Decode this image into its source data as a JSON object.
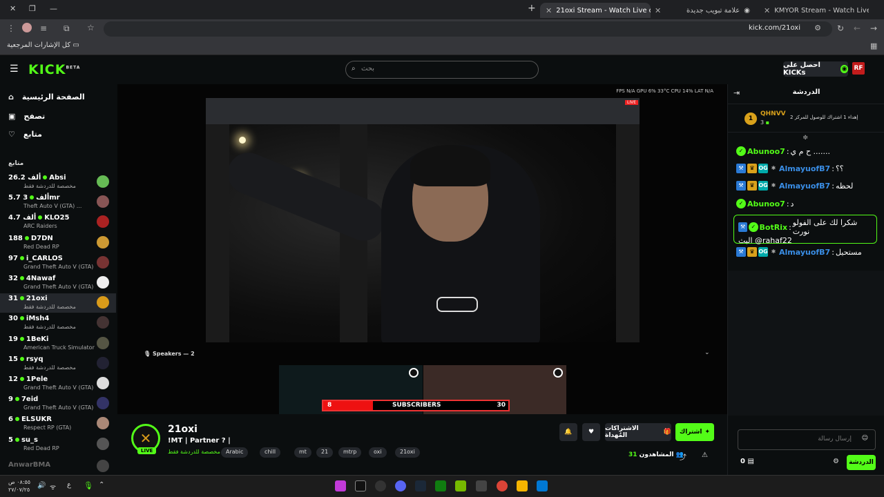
{
  "browser": {
    "tabs": [
      {
        "title": "21oxi Stream - Watch Live o",
        "active": true
      },
      {
        "title": "علامة تبويب جديدة",
        "active": false
      },
      {
        "title": "KMYOR Stream - Watch Live on",
        "active": false
      }
    ],
    "url": "kick.com/21oxi",
    "bookmarks_all": "كل الإشارات المرجعية"
  },
  "header": {
    "logo": "KICK",
    "logo_badge": "BETA",
    "search_placeholder": "بحث",
    "get_kicks": "احصل على KICKs",
    "user_avatar": "RF"
  },
  "sidebar": {
    "nav": [
      {
        "label": "الصفحة الرئيسية",
        "icon": "home-icon"
      },
      {
        "label": "تصفح",
        "icon": "browse-icon"
      },
      {
        "label": "متابع",
        "icon": "heart-icon"
      }
    ],
    "following_title": "متابع",
    "channels": [
      {
        "viewers": "26.2 ألف",
        "name": "Absi",
        "category": "مخصصة للدردشة فقط"
      },
      {
        "viewers": "5.7 ألف",
        "name": "3mr",
        "category": "Theft Auto V (GTA) ..."
      },
      {
        "viewers": "4.7 ألف",
        "name": "KLO25",
        "category": "ARC Raiders"
      },
      {
        "viewers": "188",
        "name": "D7DN",
        "category": "Red Dead RP"
      },
      {
        "viewers": "97",
        "name": "i_CARLOS",
        "category": "Grand Theft Auto V (GTA)"
      },
      {
        "viewers": "32",
        "name": "4Nawaf",
        "category": "Grand Theft Auto V (GTA)"
      },
      {
        "viewers": "31",
        "name": "21oxi",
        "category": "مخصصة للدردشة فقط",
        "active": true
      },
      {
        "viewers": "30",
        "name": "iMsh4",
        "category": "مخصصة للدردشة فقط"
      },
      {
        "viewers": "19",
        "name": "1BeKi",
        "category": "American Truck Simulator"
      },
      {
        "viewers": "15",
        "name": "rsyq",
        "category": "مخصصة للدردشة فقط"
      },
      {
        "viewers": "12",
        "name": "1Pele",
        "category": "Grand Theft Auto V (GTA)"
      },
      {
        "viewers": "9",
        "name": "7eid",
        "category": "Grand Theft Auto V (GTA)"
      },
      {
        "viewers": "6",
        "name": "ELSUKR",
        "category": "Respect RP (GTA)"
      },
      {
        "viewers": "5",
        "name": "su_s",
        "category": "Red Dead RP"
      }
    ],
    "offline_channel": "AnwarBMA"
  },
  "video": {
    "stats": "FPS N/A   GPU 6%  33°C   CPU 14%   LAT N/A",
    "live_label": "LIVE",
    "speakers": "Speakers — 2",
    "subs_current": "8",
    "subs_label": "SUBSCRIBERS",
    "subs_goal": "30",
    "subs_progress": 0.27
  },
  "stream": {
    "name": "21oxi",
    "title": "!MT | Partner ? |",
    "category": "مخصصة للدردشة فقط",
    "live": "LIVE",
    "tags": [
      "Arabic",
      "chill",
      "mt",
      "21",
      "mtrp",
      "oxi",
      "21oxi"
    ],
    "subscribe": "اشتراك",
    "gift_subs": "الاشتراكات المُهداة",
    "viewers_label": "المشاهدون",
    "viewers": "31"
  },
  "chat": {
    "title": "الدردشة",
    "pinned": {
      "rank": "1",
      "user": "QHNVV",
      "count": "3",
      "text": "إهداء 1 اشتراك للوصول للمركز 2"
    },
    "messages": [
      {
        "user": "Abunoo7",
        "text": "ح م ي .......",
        "style": "green"
      },
      {
        "user": "AlmayuofB7",
        "text": "؟؟",
        "style": "blue"
      },
      {
        "user": "AlmayuofB7",
        "text": "لحظه",
        "style": "blue"
      },
      {
        "user": "Abunoo7",
        "text": "د",
        "style": "green"
      },
      {
        "user": "AlmayuofB7",
        "text": "مستحيل",
        "style": "blue"
      }
    ],
    "bot": {
      "user": "BotRix",
      "line1": "شكرا لك على الفولو نورت",
      "line2": "البث @rahaf22"
    },
    "input_placeholder": "إرسال رسالة",
    "send": "الدردشة",
    "kicks": "0"
  },
  "taskbar": {
    "time": "٠٨:٥٥ ص",
    "date": "٢٧/٠٧/٢٥",
    "lang": "ع"
  }
}
